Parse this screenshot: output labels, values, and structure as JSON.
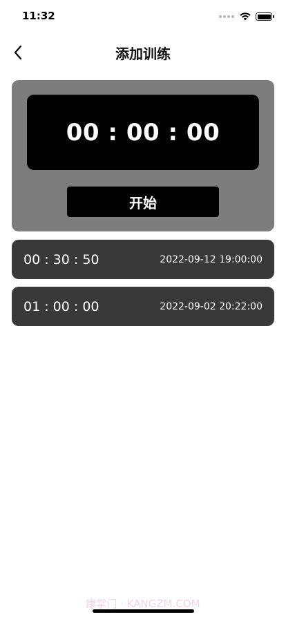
{
  "status_bar": {
    "time": "11:32",
    "icons": [
      "cellular-signal-icon",
      "wifi-icon",
      "battery-icon"
    ]
  },
  "nav": {
    "title": "添加训练",
    "back_icon": "chevron-left-icon"
  },
  "timer": {
    "display": "00 : 00 : 00",
    "start_label": "开始"
  },
  "history": [
    {
      "duration": "00 : 30 : 50",
      "datetime": "2022-09-12 19:00:00"
    },
    {
      "duration": "01 : 00 : 00",
      "datetime": "2022-09-02 20:22:00"
    }
  ],
  "watermark": "康掌门 · KANGZM.COM",
  "colors": {
    "card_bg": "#7d7d7d",
    "display_bg": "#000000",
    "row_bg": "#393939",
    "text_on_dark": "#ffffff"
  }
}
